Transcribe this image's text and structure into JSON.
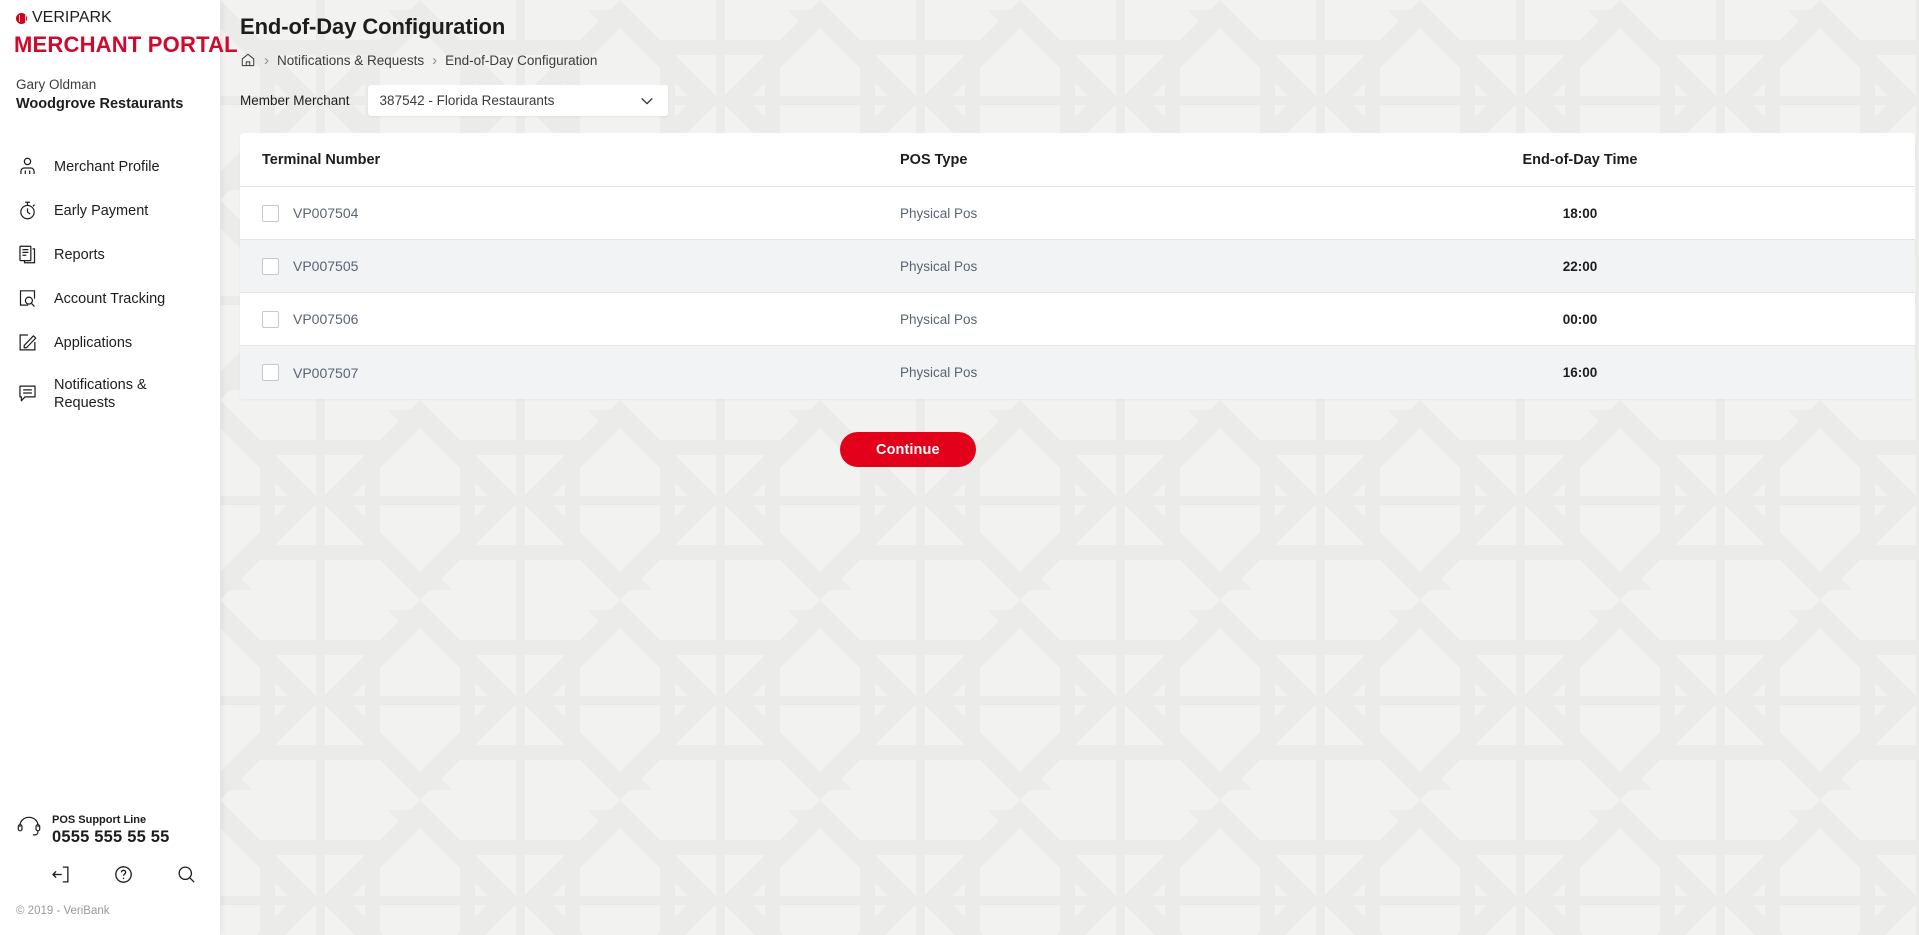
{
  "brand": {
    "logo_top": "VERIPARK",
    "logo_main": "MERCHANT PORTAL",
    "accent_red": "#cf0a2c",
    "button_red": "#e2001a"
  },
  "user": {
    "name": "Gary Oldman",
    "company": "Woodgrove Restaurants"
  },
  "sidebar": {
    "items": [
      {
        "label": "Merchant Profile",
        "icon": "user-icon"
      },
      {
        "label": "Early Payment",
        "icon": "stopwatch-icon"
      },
      {
        "label": "Reports",
        "icon": "documents-icon"
      },
      {
        "label": "Account Tracking",
        "icon": "account-search-icon"
      },
      {
        "label": "Applications",
        "icon": "edit-square-icon"
      },
      {
        "label": "Notifications & Requests",
        "icon": "chat-icon"
      }
    ],
    "support": {
      "title": "POS Support Line",
      "phone": "0555 555 55 55",
      "icon": "headset-icon"
    },
    "bottom_icons": [
      {
        "name": "logout-icon"
      },
      {
        "name": "help-icon"
      },
      {
        "name": "search-icon"
      }
    ],
    "copyright": "© 2019 - VeriBank"
  },
  "header": {
    "title": "End-of-Day Configuration",
    "breadcrumb": {
      "home_icon": "home-icon",
      "items": [
        "Notifications & Requests",
        "End-of-Day Configuration"
      ],
      "separator": "›"
    }
  },
  "filter": {
    "label": "Member Merchant",
    "selected": "387542 - Florida Restaurants",
    "caret_icon": "chevron-down-icon"
  },
  "table": {
    "columns": [
      "Terminal Number",
      "POS Type",
      "End-of-Day Time"
    ],
    "rows": [
      {
        "checked": false,
        "terminal": "VP007504",
        "pos_type": "Physical Pos",
        "eod_time": "18:00"
      },
      {
        "checked": false,
        "terminal": "VP007505",
        "pos_type": "Physical Pos",
        "eod_time": "22:00"
      },
      {
        "checked": false,
        "terminal": "VP007506",
        "pos_type": "Physical Pos",
        "eod_time": "00:00"
      },
      {
        "checked": false,
        "terminal": "VP007507",
        "pos_type": "Physical Pos",
        "eod_time": "16:00"
      }
    ]
  },
  "actions": {
    "continue_label": "Continue"
  }
}
